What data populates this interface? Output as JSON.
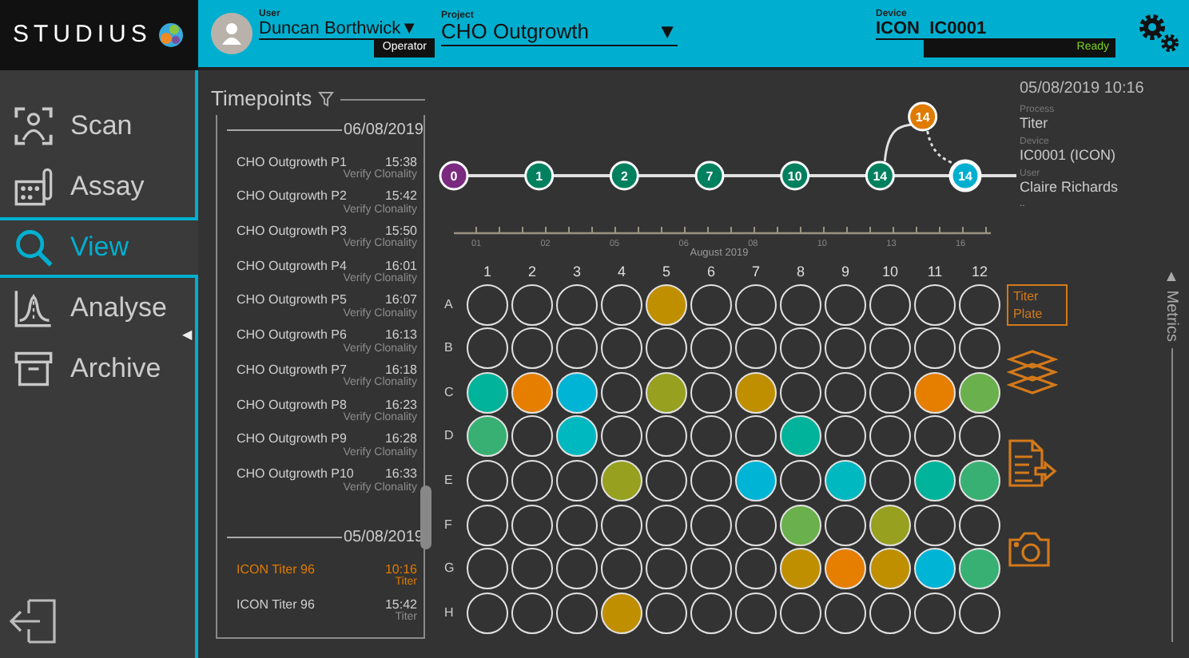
{
  "logo": {
    "text": "STUDIUS"
  },
  "header": {
    "user": {
      "label": "User",
      "name": "Duncan Borthwick",
      "caret": "▼",
      "role": "Operator"
    },
    "project": {
      "label": "Project",
      "name": "CHO Outgrowth",
      "caret": "▼"
    },
    "device": {
      "label": "Device",
      "name": "ICON  IC0001",
      "status": "Ready"
    }
  },
  "nav": [
    {
      "label": "Scan",
      "kind": "scan",
      "selected": false
    },
    {
      "label": "Assay",
      "kind": "assay",
      "selected": false
    },
    {
      "label": "View",
      "kind": "view",
      "selected": true
    },
    {
      "label": "Analyse",
      "kind": "analyse",
      "selected": false
    },
    {
      "label": "Archive",
      "kind": "archive",
      "selected": false
    }
  ],
  "nav_toggle": "◀",
  "timepoints": {
    "title": "Timepoints",
    "groups": [
      {
        "date": "06/08/2019",
        "items": [
          {
            "name": "CHO Outgrowth P1",
            "time": "15:38",
            "process": "Verify Clonality",
            "selected": false
          },
          {
            "name": "CHO Outgrowth P2",
            "time": "15:42",
            "process": "Verify Clonality",
            "selected": false
          },
          {
            "name": "CHO Outgrowth P3",
            "time": "15:50",
            "process": "Verify Clonality",
            "selected": false
          },
          {
            "name": "CHO Outgrowth P4",
            "time": "16:01",
            "process": "Verify Clonality",
            "selected": false
          },
          {
            "name": "CHO Outgrowth P5",
            "time": "16:07",
            "process": "Verify Clonality",
            "selected": false
          },
          {
            "name": "CHO Outgrowth P6",
            "time": "16:13",
            "process": "Verify Clonality",
            "selected": false
          },
          {
            "name": "CHO Outgrowth P7",
            "time": "16:18",
            "process": "Verify Clonality",
            "selected": false
          },
          {
            "name": "CHO Outgrowth P8",
            "time": "16:23",
            "process": "Verify Clonality",
            "selected": false
          },
          {
            "name": "CHO Outgrowth P9",
            "time": "16:28",
            "process": "Verify Clonality",
            "selected": false
          },
          {
            "name": "CHO Outgrowth P10",
            "time": "16:33",
            "process": "Verify Clonality",
            "selected": false
          }
        ]
      },
      {
        "date": "05/08/2019",
        "items": [
          {
            "name": "ICON Titer 96",
            "time": "10:16",
            "process": "Titer",
            "selected": true
          },
          {
            "name": "ICON Titer 96",
            "time": "15:42",
            "process": "Titer",
            "selected": false
          }
        ]
      }
    ]
  },
  "timeline": {
    "nodes": [
      {
        "label": "0",
        "kind": "main",
        "color": "#7b2a7f",
        "selected": false
      },
      {
        "label": "1",
        "kind": "main",
        "color": "#00805e",
        "selected": false
      },
      {
        "label": "2",
        "kind": "main",
        "color": "#00805e",
        "selected": false
      },
      {
        "label": "7",
        "kind": "main",
        "color": "#00805e",
        "selected": false
      },
      {
        "label": "10",
        "kind": "main",
        "color": "#00805e",
        "selected": false
      },
      {
        "label": "14",
        "kind": "main",
        "color": "#00805e",
        "selected": false
      },
      {
        "label": "14",
        "kind": "branch",
        "color": "#e07b00",
        "selected": false
      },
      {
        "label": "14",
        "kind": "main",
        "color": "#00afd0",
        "selected": true
      }
    ],
    "axis": {
      "ticks": [
        "01",
        "02",
        "05",
        "06",
        "08",
        "10",
        "13",
        "16"
      ],
      "label": "August 2019"
    }
  },
  "details": {
    "datetime": "05/08/2019 10:16",
    "fields": [
      {
        "label": "Process",
        "value": "Titer"
      },
      {
        "label": "Device",
        "value": "IC0001 (ICON)"
      },
      {
        "label": "User",
        "value": "Claire Richards"
      }
    ],
    "more": ".."
  },
  "plate": {
    "columns": [
      "1",
      "2",
      "3",
      "4",
      "5",
      "6",
      "7",
      "8",
      "9",
      "10",
      "11",
      "12"
    ],
    "rows": [
      {
        "label": "A",
        "wells": [
          {
            "filled": false
          },
          {
            "filled": false
          },
          {
            "filled": false
          },
          {
            "filled": false
          },
          {
            "filled": true,
            "color": "#bf8f00"
          },
          {
            "filled": false
          },
          {
            "filled": false
          },
          {
            "filled": false
          },
          {
            "filled": false
          },
          {
            "filled": false
          },
          {
            "filled": false
          },
          {
            "filled": false
          }
        ]
      },
      {
        "label": "B",
        "wells": [
          {
            "filled": false
          },
          {
            "filled": false
          },
          {
            "filled": false
          },
          {
            "filled": false
          },
          {
            "filled": false
          },
          {
            "filled": false
          },
          {
            "filled": false
          },
          {
            "filled": false
          },
          {
            "filled": false
          },
          {
            "filled": false
          },
          {
            "filled": false
          },
          {
            "filled": false
          }
        ]
      },
      {
        "label": "C",
        "wells": [
          {
            "filled": true,
            "color": "#00b39a"
          },
          {
            "filled": true,
            "color": "#e67e00"
          },
          {
            "filled": true,
            "color": "#00b4d6"
          },
          {
            "filled": false
          },
          {
            "filled": true,
            "color": "#97a01f"
          },
          {
            "filled": false
          },
          {
            "filled": true,
            "color": "#bf8f00"
          },
          {
            "filled": false
          },
          {
            "filled": false
          },
          {
            "filled": false
          },
          {
            "filled": true,
            "color": "#e67e00"
          },
          {
            "filled": true,
            "color": "#6ab04c"
          }
        ]
      },
      {
        "label": "D",
        "wells": [
          {
            "filled": true,
            "color": "#38b074"
          },
          {
            "filled": false
          },
          {
            "filled": true,
            "color": "#00b8c0"
          },
          {
            "filled": false
          },
          {
            "filled": false
          },
          {
            "filled": false
          },
          {
            "filled": false
          },
          {
            "filled": true,
            "color": "#00b39a"
          },
          {
            "filled": false
          },
          {
            "filled": false
          },
          {
            "filled": false
          },
          {
            "filled": false
          }
        ]
      },
      {
        "label": "E",
        "wells": [
          {
            "filled": false
          },
          {
            "filled": false
          },
          {
            "filled": false
          },
          {
            "filled": true,
            "color": "#97a01f"
          },
          {
            "filled": false
          },
          {
            "filled": false
          },
          {
            "filled": true,
            "color": "#00b4d6"
          },
          {
            "filled": false
          },
          {
            "filled": true,
            "color": "#00b8c0"
          },
          {
            "filled": false
          },
          {
            "filled": true,
            "color": "#00b39a"
          },
          {
            "filled": true,
            "color": "#38b074"
          }
        ]
      },
      {
        "label": "F",
        "wells": [
          {
            "filled": false
          },
          {
            "filled": false
          },
          {
            "filled": false
          },
          {
            "filled": false
          },
          {
            "filled": false
          },
          {
            "filled": false
          },
          {
            "filled": false
          },
          {
            "filled": true,
            "color": "#6ab04c"
          },
          {
            "filled": false
          },
          {
            "filled": true,
            "color": "#97a01f"
          },
          {
            "filled": false
          },
          {
            "filled": false
          }
        ]
      },
      {
        "label": "G",
        "wells": [
          {
            "filled": false
          },
          {
            "filled": false
          },
          {
            "filled": false
          },
          {
            "filled": false
          },
          {
            "filled": false
          },
          {
            "filled": false
          },
          {
            "filled": false
          },
          {
            "filled": true,
            "color": "#bf8f00"
          },
          {
            "filled": true,
            "color": "#e67e00"
          },
          {
            "filled": true,
            "color": "#bf8f00"
          },
          {
            "filled": true,
            "color": "#00b4d6"
          },
          {
            "filled": true,
            "color": "#38b074"
          }
        ]
      },
      {
        "label": "H",
        "wells": [
          {
            "filled": false
          },
          {
            "filled": false
          },
          {
            "filled": false
          },
          {
            "filled": true,
            "color": "#bf8f00"
          },
          {
            "filled": false
          },
          {
            "filled": false
          },
          {
            "filled": false
          },
          {
            "filled": false
          },
          {
            "filled": false
          },
          {
            "filled": false
          },
          {
            "filled": false
          },
          {
            "filled": false
          }
        ]
      }
    ]
  },
  "tools": [
    {
      "kind": "text",
      "label": "Titer Plate"
    },
    {
      "kind": "layers"
    },
    {
      "kind": "export"
    },
    {
      "kind": "camera"
    }
  ],
  "metrics": {
    "label": "Metrics",
    "caret": "▲"
  }
}
